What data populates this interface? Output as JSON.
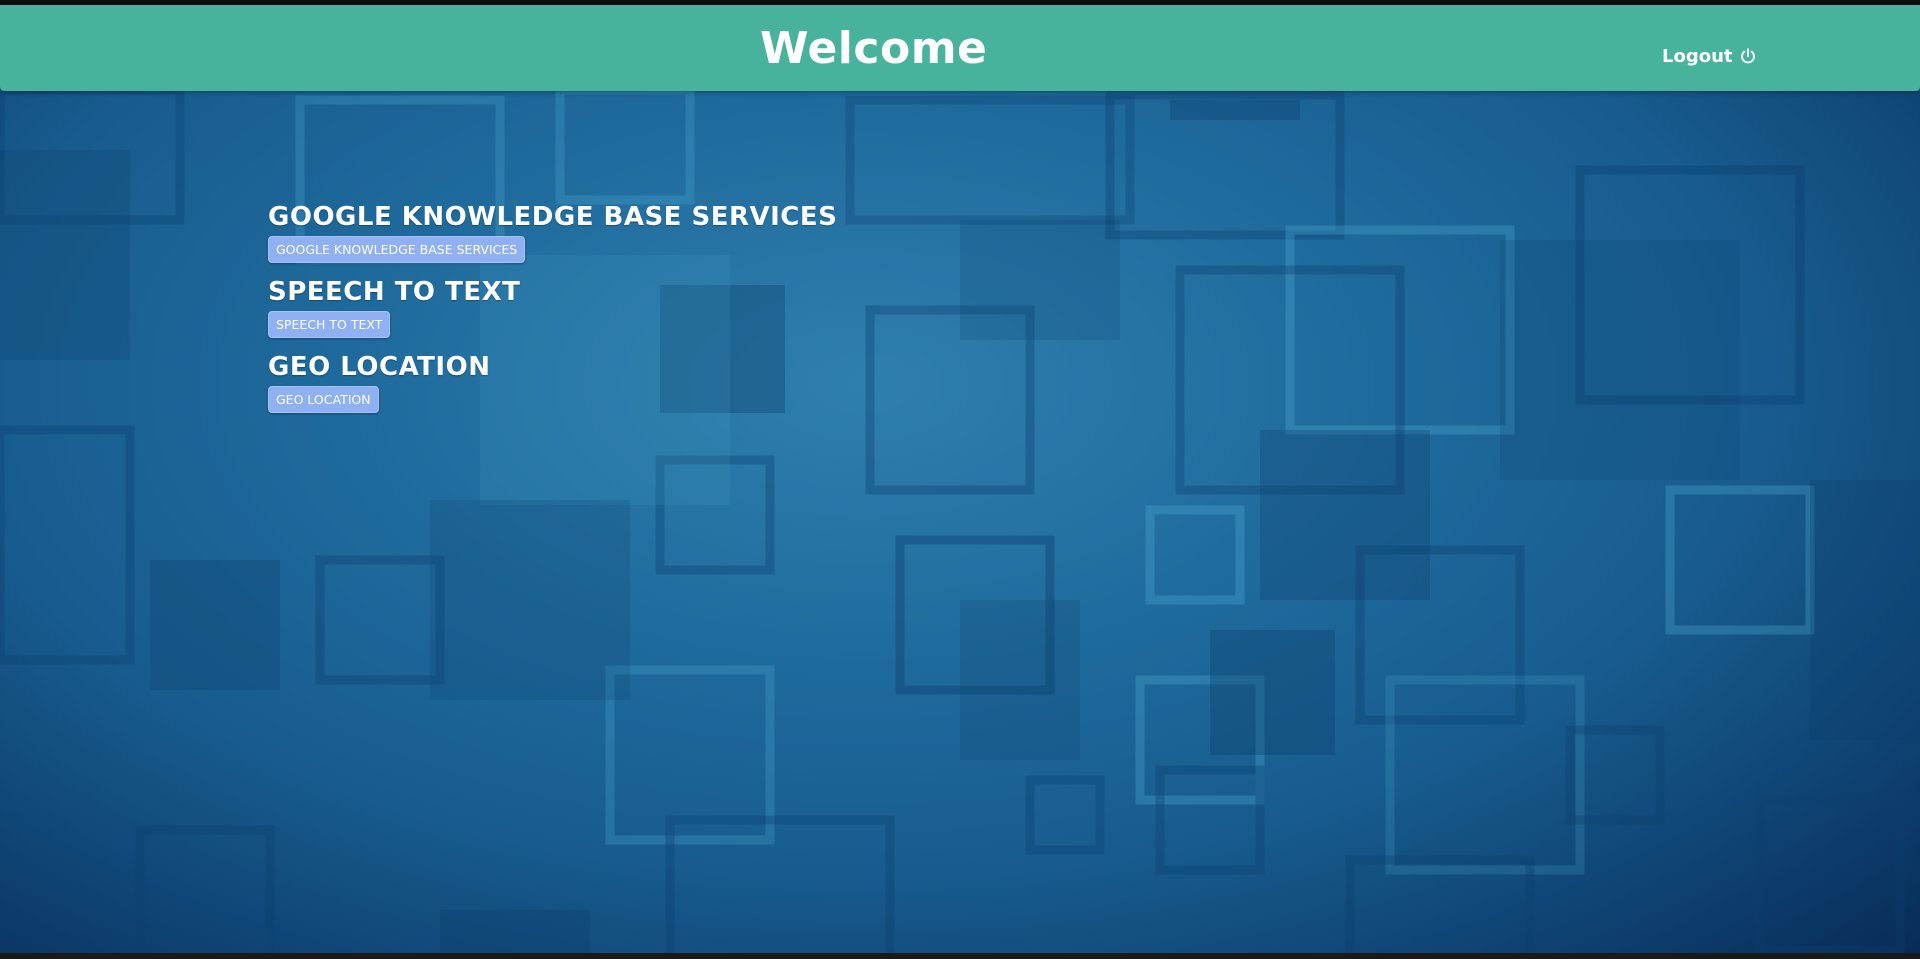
{
  "header": {
    "title": "Welcome",
    "logout_label": "Logout",
    "logout_icon": "power-icon"
  },
  "services": [
    {
      "title": "GOOGLE KNOWLEDGE BASE SERVICES",
      "button_label": "GOOGLE KNOWLEDGE BASE SERVICES"
    },
    {
      "title": "SPEECH TO TEXT",
      "button_label": "SPEECH TO TEXT"
    },
    {
      "title": "GEO LOCATION",
      "button_label": "GEO LOCATION"
    }
  ],
  "colors": {
    "header_bg": "#47b39c",
    "button_bg": "#8fb0f2",
    "background": "#1f6a9c"
  }
}
